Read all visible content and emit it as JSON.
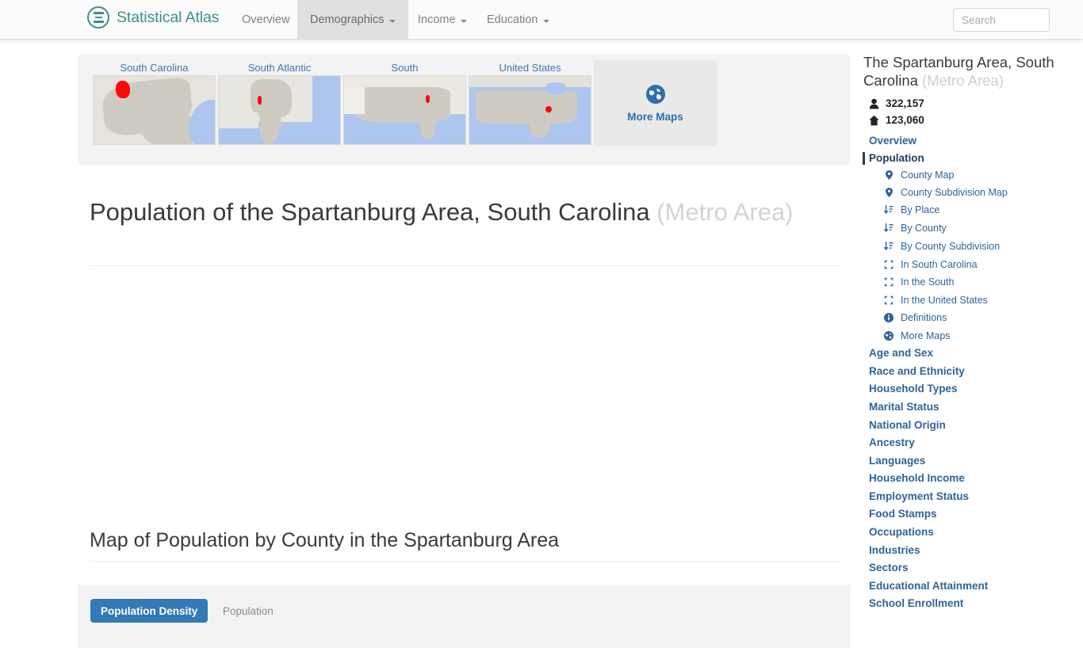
{
  "topnav": {
    "brand": "Statistical Atlas",
    "brand_icon": "statistical-atlas-logo-icon",
    "items": [
      {
        "label": "Overview",
        "has_caret": false,
        "active": false
      },
      {
        "label": "Demographics",
        "has_caret": true,
        "active": true
      },
      {
        "label": "Income",
        "has_caret": true,
        "active": false
      },
      {
        "label": "Education",
        "has_caret": true,
        "active": false
      }
    ],
    "search": {
      "placeholder": "Search",
      "value": ""
    }
  },
  "maps_panel": {
    "cards": [
      {
        "label": "South Carolina"
      },
      {
        "label": "South Atlantic"
      },
      {
        "label": "South"
      },
      {
        "label": "United States"
      }
    ],
    "more_maps": {
      "label": "More Maps",
      "icon": "globe-icon"
    }
  },
  "main": {
    "page_title": "Population of the Spartanburg Area, South Carolina",
    "page_title_suffix": "(Metro Area)",
    "map_section_title": "Map of Population by County in the Spartanburg Area",
    "chart_tabs": [
      {
        "label": "Population Density",
        "active": true
      },
      {
        "label": "Population",
        "active": false
      }
    ]
  },
  "sidebar": {
    "title": "The Spartanburg Area, South Carolina",
    "title_suffix": "(Metro Area)",
    "stats": [
      {
        "icon": "person-icon",
        "value": "322,157"
      },
      {
        "icon": "house-icon",
        "value": "123,060"
      }
    ],
    "top_links": [
      {
        "label": "Overview",
        "current": false
      },
      {
        "label": "Population",
        "current": true
      }
    ],
    "sub_items": [
      {
        "label": "County Map",
        "icon": "map-pin-icon"
      },
      {
        "label": "County Subdivision Map",
        "icon": "map-pin-icon"
      },
      {
        "label": "By Place",
        "icon": "sort-icon"
      },
      {
        "label": "By County",
        "icon": "sort-icon"
      },
      {
        "label": "By County Subdivision",
        "icon": "sort-icon"
      },
      {
        "label": "In South Carolina",
        "icon": "expand-icon"
      },
      {
        "label": "In the South",
        "icon": "expand-icon"
      },
      {
        "label": "In the United States",
        "icon": "expand-icon"
      },
      {
        "label": "Definitions",
        "icon": "info-icon"
      },
      {
        "label": "More Maps",
        "icon": "globe-icon"
      }
    ],
    "categories": [
      {
        "label": "Age and Sex"
      },
      {
        "label": "Race and Ethnicity"
      },
      {
        "label": "Household Types"
      },
      {
        "label": "Marital Status"
      },
      {
        "label": "National Origin"
      },
      {
        "label": "Ancestry"
      },
      {
        "label": "Languages"
      },
      {
        "label": "Household Income"
      },
      {
        "label": "Employment Status"
      },
      {
        "label": "Food Stamps"
      },
      {
        "label": "Occupations"
      },
      {
        "label": "Industries"
      },
      {
        "label": "Sectors"
      },
      {
        "label": "Educational Attainment"
      },
      {
        "label": "School Enrollment"
      }
    ]
  },
  "colors": {
    "brand_teal": "#3c8f8c",
    "link_blue": "#2f6497",
    "accent_blue": "#337ab7",
    "highlight_red": "#fb0a0a",
    "water_blue": "#aec6ef",
    "panel_gray": "#f3f3f3"
  }
}
